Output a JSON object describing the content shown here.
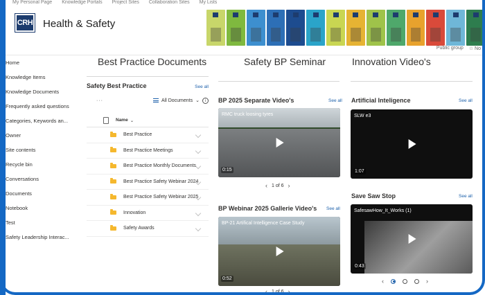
{
  "top_nav": [
    "My Personal Page",
    "Knowledge Portals",
    "Project Sites",
    "Collaboration Sites",
    "My Lists"
  ],
  "logo_text": "CRH",
  "site_title": "Health & Safety",
  "group_privacy": "Public group",
  "follow_label": "No",
  "banner_colors": [
    "#c8d66a",
    "#7fb93f",
    "#3d8fcf",
    "#2d6fb6",
    "#1d4c8f",
    "#2aa4c9",
    "#c9d652",
    "#e6b333",
    "#9fc34a",
    "#4fa86b",
    "#e8a22d",
    "#d94a3a",
    "#6fb7d8",
    "#2e7d4e"
  ],
  "sidebar": {
    "items": [
      "Home",
      "Knowledge Items",
      "Knowledge Documents",
      "Frequently asked questions",
      "Categories, Keywords an...",
      "Owner",
      "Site contents",
      "Recycle bin",
      "Conversations",
      "Documents",
      "Notebook",
      "Test",
      "Safety Leadership Interac..."
    ]
  },
  "columns": {
    "left_title": "Best Practice Documents",
    "middle_title": "Safety BP Seminar",
    "right_title": "Innovation Video's"
  },
  "doclib": {
    "title": "Safety Best Practice",
    "see_all": "See all",
    "more": "···",
    "view": "All Documents",
    "name_header": "Name",
    "rows": [
      "Best Practice",
      "Best Practice Meetings",
      "Best Practice Monthly Documents",
      "Best Practice Safety Webinar 2024",
      "Best Practice Safety Webinar 2025",
      "Innovation",
      "Safety Awards"
    ]
  },
  "videos": {
    "bp2025": {
      "section": "BP 2025 Separate Video's",
      "see_all": "See all",
      "title": "RMC truck loosing tyres",
      "duration": "0:15",
      "pager": "1 of 6"
    },
    "webinar": {
      "section": "BP Webinar 2025 Gallerie Video's",
      "see_all": "See all",
      "title": "BP-21 Artifical Intelligence Case Study",
      "duration": "0:52",
      "pager": "1 of 6"
    },
    "ai": {
      "section": "Artificial Inteligence",
      "see_all": "See all",
      "title": "SLW e3",
      "duration": "1:07"
    },
    "saw": {
      "section": "Save Saw Stop",
      "see_all": "See all",
      "title": "SafesawHow_It_Works (1)",
      "duration": "0:43"
    }
  }
}
